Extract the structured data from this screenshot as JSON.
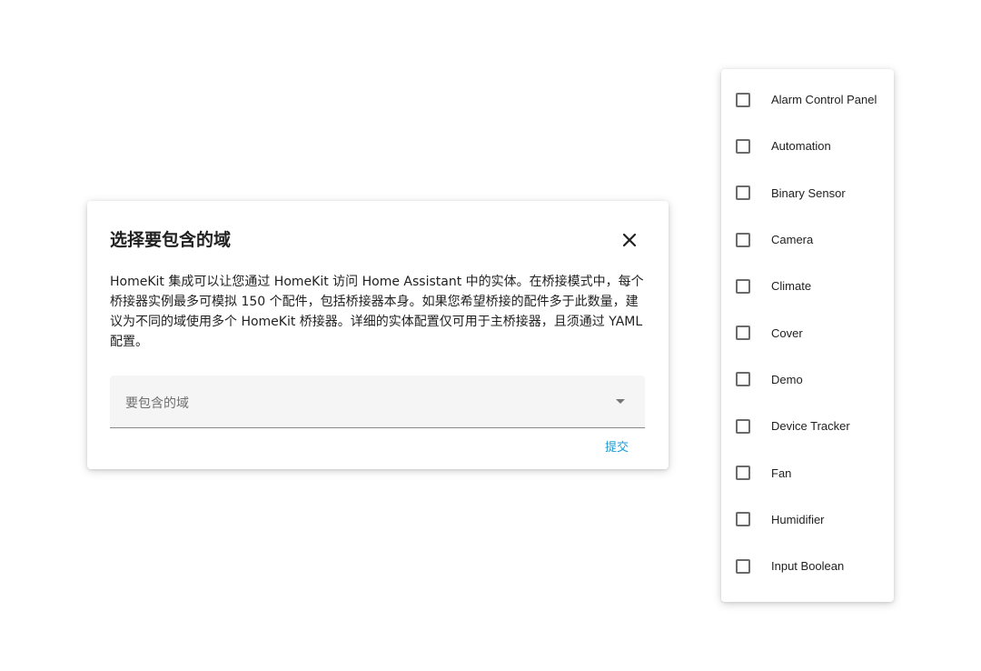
{
  "dialog": {
    "title": "选择要包含的域",
    "close_icon": "close-icon",
    "description": "HomeKit 集成可以让您通过 HomeKit 访问 Home Assistant 中的实体。在桥接模式中，每个桥接器实例最多可模拟 150 个配件，包括桥接器本身。如果您希望桥接的配件多于此数量，建议为不同的域使用多个 HomeKit 桥接器。详细的实体配置仅可用于主桥接器，且须通过 YAML 配置。",
    "select_label": "要包含的域",
    "submit_label": "提交"
  },
  "menu": {
    "items": [
      {
        "label": "Alarm Control Panel",
        "checked": false
      },
      {
        "label": "Automation",
        "checked": false
      },
      {
        "label": "Binary Sensor",
        "checked": false
      },
      {
        "label": "Camera",
        "checked": false
      },
      {
        "label": "Climate",
        "checked": false
      },
      {
        "label": "Cover",
        "checked": false
      },
      {
        "label": "Demo",
        "checked": false
      },
      {
        "label": "Device Tracker",
        "checked": false
      },
      {
        "label": "Fan",
        "checked": false
      },
      {
        "label": "Humidifier",
        "checked": false
      },
      {
        "label": "Input Boolean",
        "checked": false
      }
    ]
  },
  "colors": {
    "accent": "#1a9bd7",
    "field_bg": "#f5f5f5",
    "text": "#212121"
  }
}
